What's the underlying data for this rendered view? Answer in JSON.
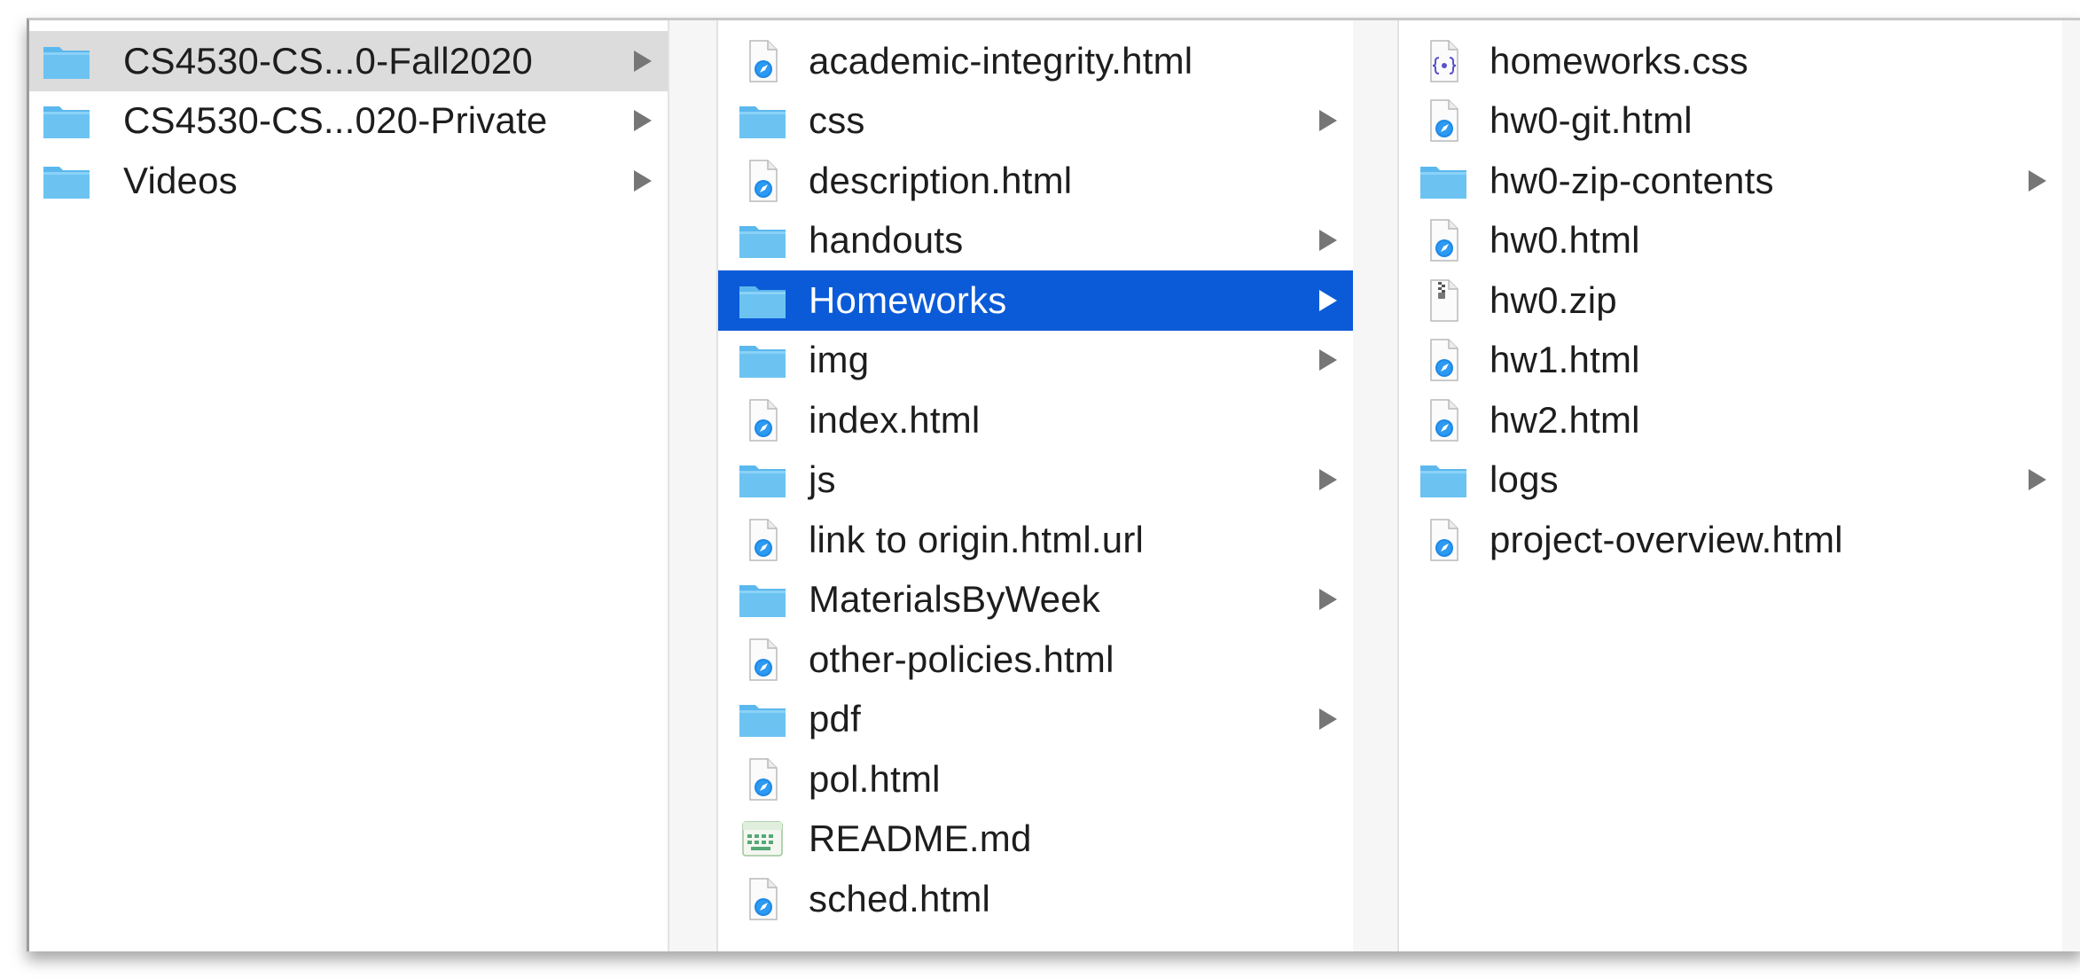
{
  "colors": {
    "selection": "#0b5bd8",
    "parent_selection": "#dcdcdc",
    "folder": "#6cc3f2"
  },
  "columns": [
    {
      "items": [
        {
          "label": "CS4530-CS...0-Fall2020",
          "icon": "folder-icon",
          "has_children": true,
          "state": "parent-selected"
        },
        {
          "label": "CS4530-CS...020-Private",
          "icon": "folder-icon",
          "has_children": true,
          "state": "normal"
        },
        {
          "label": "Videos",
          "icon": "folder-icon",
          "has_children": true,
          "state": "normal"
        }
      ]
    },
    {
      "items": [
        {
          "label": "academic-integrity.html",
          "icon": "html-file-icon",
          "has_children": false,
          "state": "normal"
        },
        {
          "label": "css",
          "icon": "folder-icon",
          "has_children": true,
          "state": "normal"
        },
        {
          "label": "description.html",
          "icon": "html-file-icon",
          "has_children": false,
          "state": "normal"
        },
        {
          "label": "handouts",
          "icon": "folder-icon",
          "has_children": true,
          "state": "normal"
        },
        {
          "label": "Homeworks",
          "icon": "folder-icon",
          "has_children": true,
          "state": "selected"
        },
        {
          "label": "img",
          "icon": "folder-icon",
          "has_children": true,
          "state": "normal"
        },
        {
          "label": "index.html",
          "icon": "html-file-icon",
          "has_children": false,
          "state": "normal"
        },
        {
          "label": "js",
          "icon": "folder-icon",
          "has_children": true,
          "state": "normal"
        },
        {
          "label": "link to origin.html.url",
          "icon": "html-file-icon",
          "has_children": false,
          "state": "normal"
        },
        {
          "label": "MaterialsByWeek",
          "icon": "folder-icon",
          "has_children": true,
          "state": "normal"
        },
        {
          "label": "other-policies.html",
          "icon": "html-file-icon",
          "has_children": false,
          "state": "normal"
        },
        {
          "label": "pdf",
          "icon": "folder-icon",
          "has_children": true,
          "state": "normal"
        },
        {
          "label": "pol.html",
          "icon": "html-file-icon",
          "has_children": false,
          "state": "normal"
        },
        {
          "label": "README.md",
          "icon": "markdown-file-icon",
          "has_children": false,
          "state": "normal"
        },
        {
          "label": "sched.html",
          "icon": "html-file-icon",
          "has_children": false,
          "state": "normal"
        }
      ]
    },
    {
      "items": [
        {
          "label": "homeworks.css",
          "icon": "css-file-icon",
          "has_children": false,
          "state": "normal"
        },
        {
          "label": "hw0-git.html",
          "icon": "html-file-icon",
          "has_children": false,
          "state": "normal"
        },
        {
          "label": "hw0-zip-contents",
          "icon": "folder-icon",
          "has_children": true,
          "state": "normal"
        },
        {
          "label": "hw0.html",
          "icon": "html-file-icon",
          "has_children": false,
          "state": "normal"
        },
        {
          "label": "hw0.zip",
          "icon": "zip-file-icon",
          "has_children": false,
          "state": "normal"
        },
        {
          "label": "hw1.html",
          "icon": "html-file-icon",
          "has_children": false,
          "state": "normal"
        },
        {
          "label": "hw2.html",
          "icon": "html-file-icon",
          "has_children": false,
          "state": "normal"
        },
        {
          "label": "logs",
          "icon": "folder-icon",
          "has_children": true,
          "state": "normal"
        },
        {
          "label": "project-overview.html",
          "icon": "html-file-icon",
          "has_children": false,
          "state": "normal"
        }
      ]
    }
  ]
}
